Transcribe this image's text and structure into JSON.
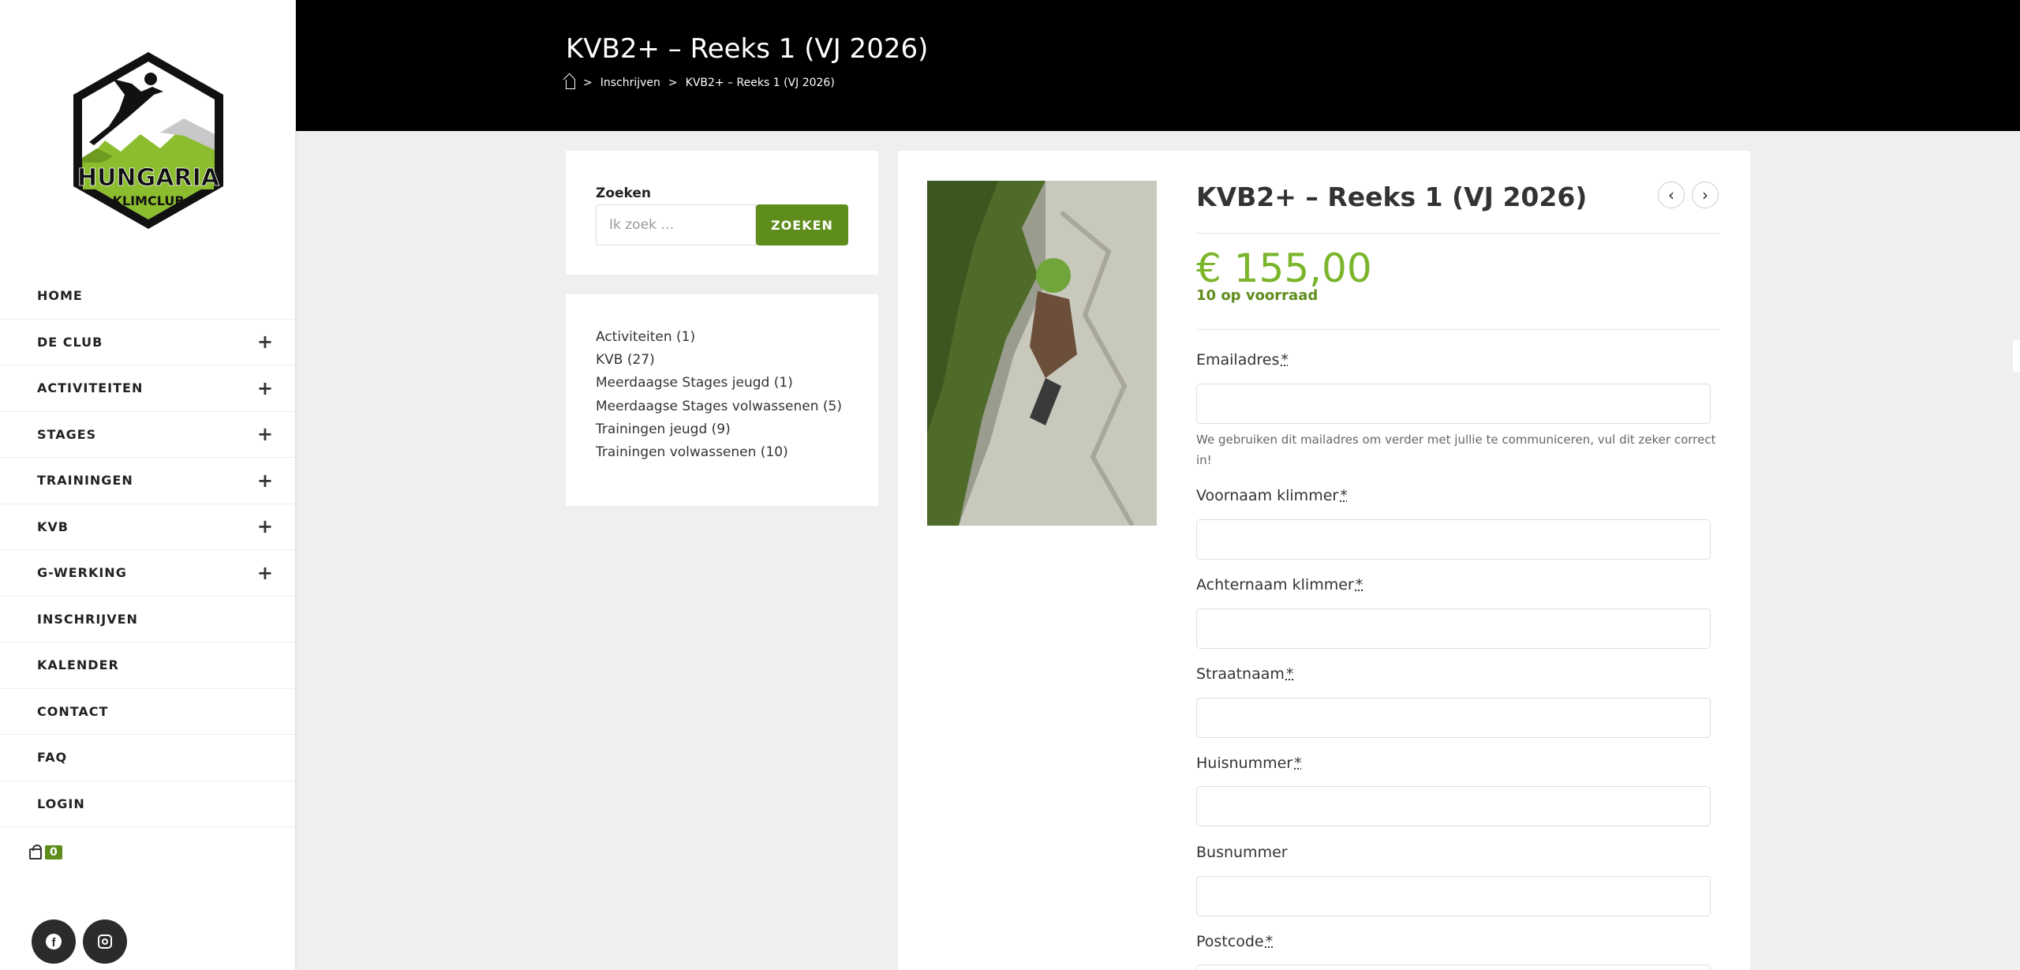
{
  "site": {
    "logo_text_top": "HUNGARIA",
    "logo_text_bottom": "KLIMCLUB",
    "accent_color": "#5f8d1c",
    "price_color": "#7bb52b"
  },
  "menu": [
    {
      "label": "HOME",
      "has_submenu": false
    },
    {
      "label": "DE CLUB",
      "has_submenu": true
    },
    {
      "label": "ACTIVITEITEN",
      "has_submenu": true
    },
    {
      "label": "STAGES",
      "has_submenu": true
    },
    {
      "label": "TRAININGEN",
      "has_submenu": true
    },
    {
      "label": "KVB",
      "has_submenu": true
    },
    {
      "label": "G-WERKING",
      "has_submenu": true
    },
    {
      "label": "INSCHRIJVEN",
      "has_submenu": false
    },
    {
      "label": "KALENDER",
      "has_submenu": false
    },
    {
      "label": "CONTACT",
      "has_submenu": false
    },
    {
      "label": "FAQ",
      "has_submenu": false
    },
    {
      "label": "LOGIN",
      "has_submenu": false
    }
  ],
  "menu_plus": "+",
  "cart": {
    "count": "0",
    "icon": "shopping-bag-icon"
  },
  "social": {
    "facebook_icon": "facebook-icon",
    "instagram_icon": "instagram-icon",
    "facebook_glyph": "f"
  },
  "header": {
    "title": "KVB2+ – Reeks 1 (VJ 2026)",
    "breadcrumb": {
      "sep": ">",
      "crumb1": "Inschrijven",
      "crumb2": "KVB2+ – Reeks 1 (VJ 2026)"
    }
  },
  "search": {
    "title": "Zoeken",
    "placeholder": "Ik zoek …",
    "button": "ZOEKEN"
  },
  "categories": [
    "Activiteiten (1)",
    "KVB (27)",
    "Meerdaagse Stages jeugd (1)",
    "Meerdaagse Stages volwassenen (5)",
    "Trainingen jeugd (9)",
    "Trainingen volwassenen (10)"
  ],
  "product": {
    "title": "KVB2+ – Reeks 1 (VJ 2026)",
    "price": "€ 155,00",
    "stock": "10 op voorraad",
    "prev_arrow": "‹",
    "next_arrow": "›"
  },
  "form": {
    "required_mark": "*",
    "email_label": "Emailadres",
    "email_hint": "We gebruiken dit mailadres om verder met jullie te communiceren, vul dit zeker correct in!",
    "firstname_label": "Voornaam klimmer",
    "lastname_label": "Achternaam klimmer",
    "street_label": "Straatnaam",
    "housenr_label": "Huisnummer",
    "busnr_label": "Busnummer",
    "postcode_label": "Postcode"
  }
}
